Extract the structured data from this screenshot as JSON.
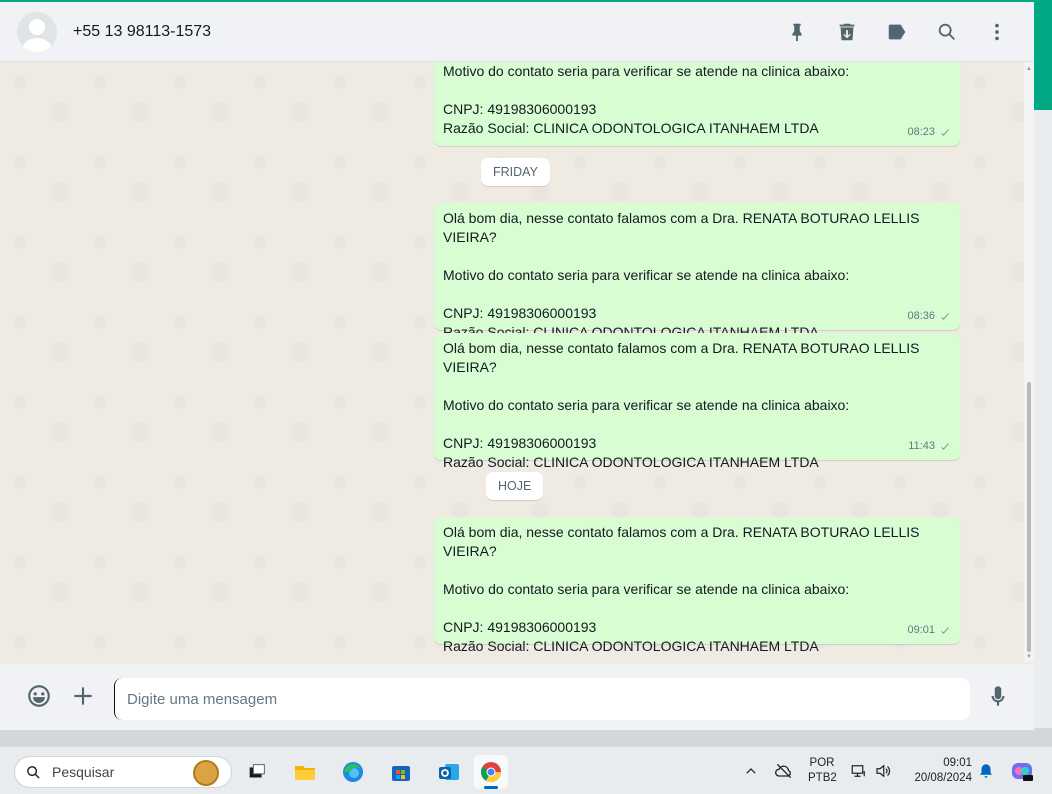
{
  "header": {
    "contact_name": "+55 13 98113-1573",
    "actions": [
      "pin-icon",
      "delete-icon",
      "label-icon",
      "search-icon",
      "menu-icon"
    ]
  },
  "messages": [
    {
      "lines": "Motivo do contato seria para verificar se atende na clinica abaixo:\n\nCNPJ: 49198306000193\nRazão Social: CLINICA ODONTOLOGICA ITANHAEM LTDA",
      "time": "08:23"
    },
    {
      "separator": "FRIDAY"
    },
    {
      "lines": "Olá bom dia, nesse contato falamos com a Dra. RENATA BOTURAO LELLIS VIEIRA?\n\nMotivo do contato seria para verificar se atende na clinica abaixo:\n\nCNPJ: 49198306000193\nRazão Social: CLINICA ODONTOLOGICA ITANHAEM LTDA",
      "time": "08:36"
    },
    {
      "lines": "Olá bom dia, nesse contato falamos com a Dra. RENATA BOTURAO LELLIS VIEIRA?\n\nMotivo do contato seria para verificar se atende na clinica abaixo:\n\nCNPJ: 49198306000193\nRazão Social: CLINICA ODONTOLOGICA ITANHAEM LTDA",
      "time": "11:43"
    },
    {
      "separator": "HOJE"
    },
    {
      "lines": "Olá bom dia, nesse contato falamos com a Dra. RENATA BOTURAO LELLIS VIEIRA?\n\nMotivo do contato seria para verificar se atende na clinica abaixo:\n\nCNPJ: 49198306000193\nRazão Social: CLINICA ODONTOLOGICA ITANHAEM LTDA",
      "time": "09:01"
    }
  ],
  "composer": {
    "placeholder": "Digite uma mensagem"
  },
  "taskbar": {
    "search_label": "Pesquisar",
    "lang_top": "POR",
    "lang_bottom": "PTB2",
    "time": "09:01",
    "date": "20/08/2024"
  },
  "colors": {
    "accent": "#00a884",
    "outgoing_bubble": "#d9fdd3",
    "chat_bg": "#efeae2"
  }
}
